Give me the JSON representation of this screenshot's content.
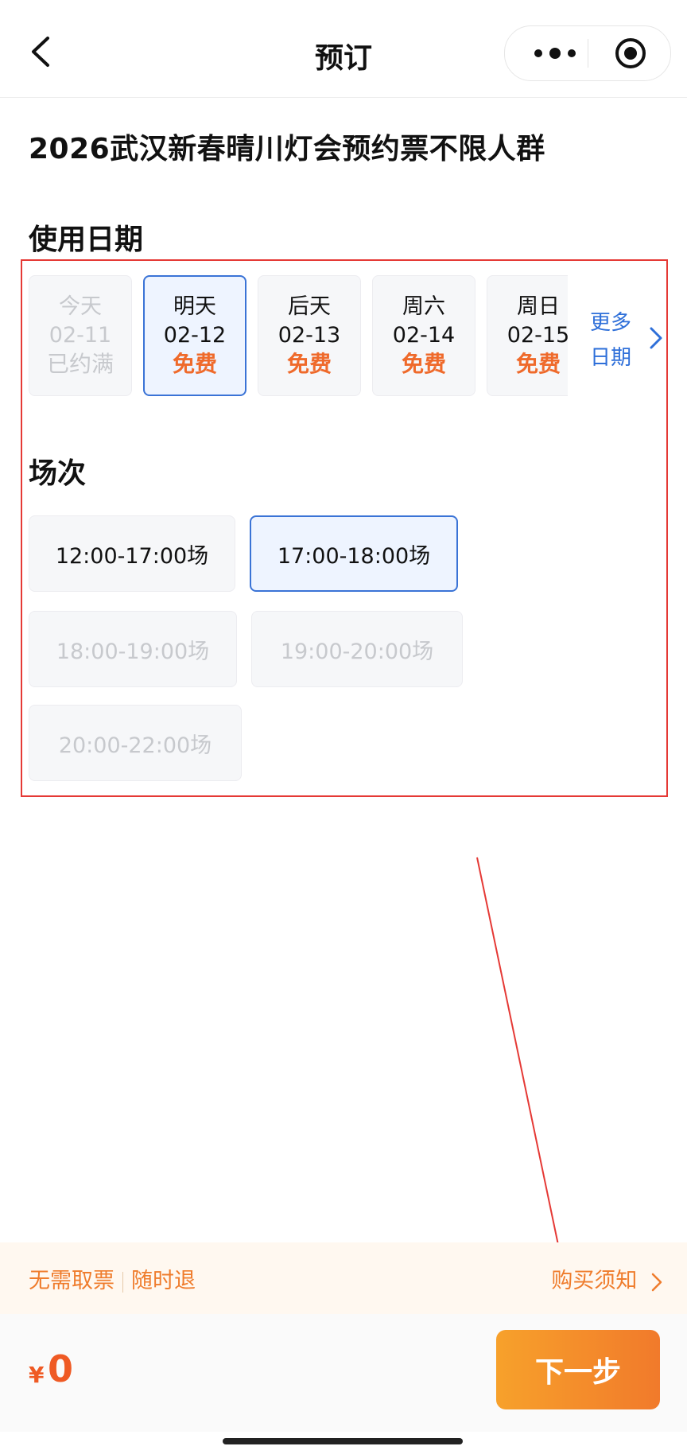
{
  "nav": {
    "title": "预订"
  },
  "page_title": "2026武汉新春晴川灯会预约票不限人群",
  "date_section": {
    "label": "使用日期",
    "dates": [
      {
        "day": "今天",
        "date": "02-11",
        "status": "已约满",
        "state": "disabled"
      },
      {
        "day": "明天",
        "date": "02-12",
        "status": "免费",
        "state": "selected"
      },
      {
        "day": "后天",
        "date": "02-13",
        "status": "免费",
        "state": "normal"
      },
      {
        "day": "周六",
        "date": "02-14",
        "status": "免费",
        "state": "normal"
      },
      {
        "day": "周日",
        "date": "02-15",
        "status": "免费",
        "state": "normal"
      }
    ],
    "more_line1": "更多",
    "more_line2": "日期"
  },
  "session_section": {
    "label": "场次",
    "sessions": [
      {
        "label": "12:00-17:00场",
        "state": "normal"
      },
      {
        "label": "17:00-18:00场",
        "state": "selected"
      },
      {
        "label": "18:00-19:00场",
        "state": "disabled"
      },
      {
        "label": "19:00-20:00场",
        "state": "disabled"
      },
      {
        "label": "20:00-22:00场",
        "state": "disabled"
      }
    ]
  },
  "notice": {
    "left_1": "无需取票",
    "left_2": "随时退",
    "right": "购买须知"
  },
  "bottom": {
    "currency": "¥",
    "price": "0",
    "next_button": "下一步"
  },
  "colors": {
    "accent_orange": "#ef6a2b",
    "selected_blue": "#3a73d6",
    "annotation_red": "#e53935"
  }
}
